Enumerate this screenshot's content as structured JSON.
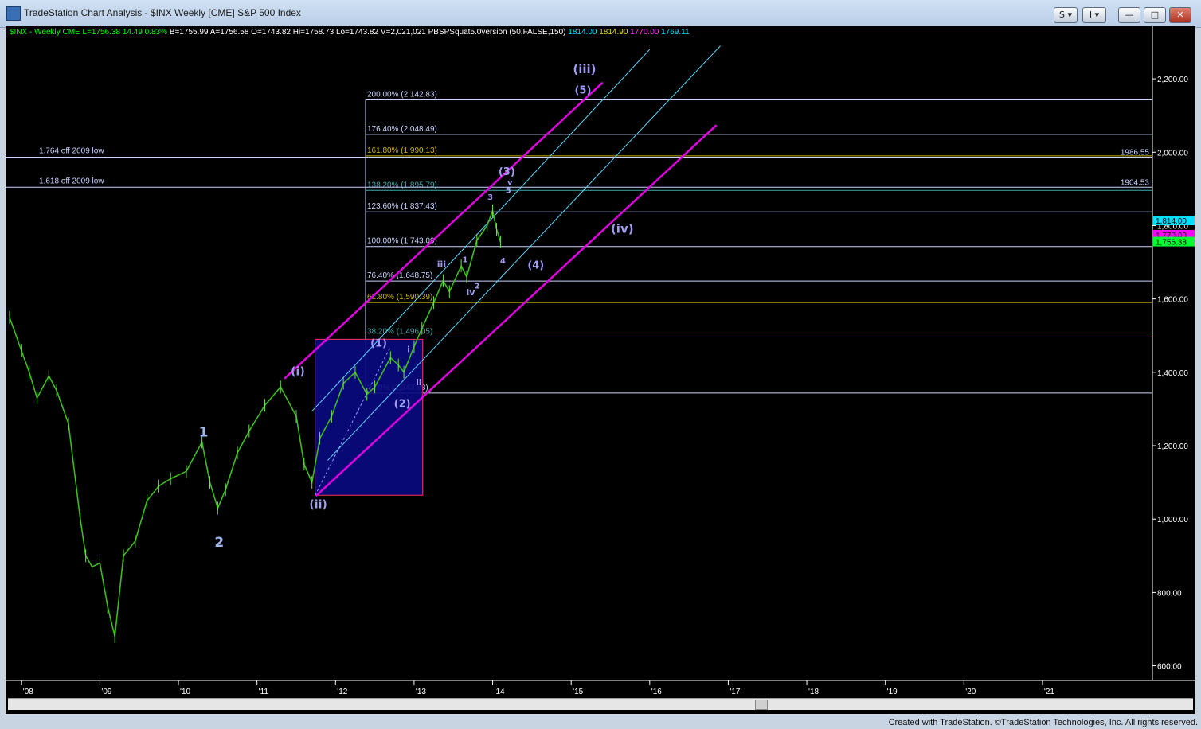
{
  "window": {
    "title": "TradeStation Chart Analysis - $INX Weekly [CME] S&P 500 Index",
    "buttons": {
      "s_label": "S ▾",
      "i_label": "I ▾",
      "min": "—",
      "max": "□",
      "close": "✕"
    }
  },
  "header": {
    "symbol": "$INX - Weekly  CME",
    "last": "L=1756.38",
    "chg": "14.49",
    "pct": "0.83%",
    "bid": "B=1755.99",
    "ask": "A=1756.58",
    "open": "O=1743.82",
    "high": "Hi=1758.73",
    "low": "Lo=1743.82",
    "vol": "V=2,021,021",
    "indicator": "PBSPSquat5.0version (50,FALSE,150)",
    "ind_v1": "1814.00",
    "ind_v2": "1814.90",
    "ind_v3": "1770.00",
    "ind_v4": "1769.11"
  },
  "footer": {
    "credit": "Created with TradeStation. ©TradeStation Technologies, Inc. All rights reserved."
  },
  "chart_data": {
    "type": "line",
    "title": "$INX Weekly S&P 500 Index",
    "ylim": [
      560,
      2300
    ],
    "y_ticks": [
      600,
      800,
      1000,
      1200,
      1400,
      1600,
      1800,
      2000,
      2200
    ],
    "y_tick_labels": [
      "600.00",
      "800.00",
      "1,000.00",
      "1,200.00",
      "1,400.00",
      "1,600.00",
      "1,800.00",
      "2,000.00",
      "2,200.00"
    ],
    "x_range_years": [
      2007.85,
      2022.4
    ],
    "x_ticks": [
      2008,
      2009,
      2010,
      2011,
      2012,
      2013,
      2014,
      2015,
      2016,
      2017,
      2018,
      2019,
      2020,
      2021
    ],
    "x_tick_labels": [
      "'08",
      "'09",
      "'10",
      "'11",
      "'12",
      "'13",
      "'14",
      "'15",
      "'16",
      "'17",
      "'18",
      "'19",
      "'20",
      "'21"
    ],
    "series": [
      {
        "x": [
          2007.85,
          2008.0,
          2008.1,
          2008.2,
          2008.35,
          2008.45,
          2008.6,
          2008.75,
          2008.82,
          2008.9,
          2009.0,
          2009.1,
          2009.19,
          2009.3,
          2009.45,
          2009.6,
          2009.75,
          2009.9,
          2010.1,
          2010.3,
          2010.4,
          2010.5,
          2010.6,
          2010.75,
          2010.9,
          2011.1,
          2011.3,
          2011.5,
          2011.6,
          2011.7,
          2011.8,
          2011.95,
          2012.1,
          2012.25,
          2012.4,
          2012.5,
          2012.7,
          2012.8,
          2012.87,
          2013.0,
          2013.1,
          2013.25,
          2013.37,
          2013.45,
          2013.6,
          2013.67,
          2013.8,
          2013.93,
          2014.0,
          2014.05,
          2014.1
        ],
        "values": [
          1550,
          1460,
          1400,
          1330,
          1390,
          1350,
          1260,
          1000,
          900,
          870,
          880,
          760,
          680,
          900,
          940,
          1050,
          1090,
          1110,
          1130,
          1210,
          1100,
          1030,
          1080,
          1180,
          1240,
          1310,
          1360,
          1280,
          1150,
          1100,
          1220,
          1280,
          1370,
          1400,
          1340,
          1360,
          1440,
          1420,
          1400,
          1470,
          1520,
          1590,
          1650,
          1620,
          1690,
          1660,
          1760,
          1800,
          1840,
          1790,
          1756
        ]
      }
    ],
    "channels": [
      {
        "name": "outer",
        "color": "#e000e0",
        "points": [
          [
            2011.35,
            1383
          ],
          [
            2015.4,
            2190
          ]
        ]
      },
      {
        "name": "lower",
        "color": "#e000e0",
        "points": [
          [
            2011.75,
            1063
          ],
          [
            2016.85,
            2074
          ]
        ]
      },
      {
        "name": "inner-a",
        "color": "#5ad8ff",
        "points": [
          [
            2011.7,
            1294
          ],
          [
            2016.0,
            2280
          ]
        ]
      },
      {
        "name": "inner-b",
        "color": "#5ad8ff",
        "points": [
          [
            2011.9,
            1160
          ],
          [
            2016.9,
            2290
          ]
        ]
      }
    ],
    "fib_levels": [
      {
        "label": "200.00% (2,142.83)",
        "value": 2142.83,
        "color": "#c9d3ff"
      },
      {
        "label": "176.40% (2,048.49)",
        "value": 2048.49,
        "color": "#c9d3ff"
      },
      {
        "label": "161.80% (1,990.13)",
        "value": 1990.13,
        "color": "#c8b400"
      },
      {
        "label": "138.20% (1,895.79)",
        "value": 1895.79,
        "color": "#3fa9a9"
      },
      {
        "label": "123.60% (1,837.43)",
        "value": 1837.43,
        "color": "#c9d3ff"
      },
      {
        "label": "100.00% (1,743.09)",
        "value": 1743.09,
        "color": "#c9d3ff"
      },
      {
        "label": "76.40% (1,648.75)",
        "value": 1648.75,
        "color": "#c9d3ff"
      },
      {
        "label": "61.80% (1,590.39)",
        "value": 1590.39,
        "color": "#c8b400"
      },
      {
        "label": "38.20% (1,496.05)",
        "value": 1496.05,
        "color": "#3fa9a9"
      },
      {
        "label": "0.00% (1,343.38)",
        "value": 1343.38,
        "color": "#c9d3ff"
      }
    ],
    "long_levels": [
      {
        "label": "1.764 off 2009 low",
        "value": 1986.55,
        "right_label": "1986.55"
      },
      {
        "label": "1.618 off 2009 low",
        "value": 1904.53,
        "right_label": "1904.53"
      }
    ],
    "wave_labels": [
      {
        "text": "1",
        "x": 2010.32,
        "y": 1225,
        "color": "#9fb8e8",
        "size": 17
      },
      {
        "text": "2",
        "x": 2010.52,
        "y": 925,
        "color": "#9fb8e8",
        "size": 17
      },
      {
        "text": "(i)",
        "x": 2011.52,
        "y": 1392,
        "color": "#a09cf0",
        "size": 14
      },
      {
        "text": "(ii)",
        "x": 2011.78,
        "y": 1030,
        "color": "#a09cf0",
        "size": 14
      },
      {
        "text": "(1)",
        "x": 2012.55,
        "y": 1470,
        "color": "#a09cf0",
        "size": 13
      },
      {
        "text": "(2)",
        "x": 2012.85,
        "y": 1305,
        "color": "#a09cf0",
        "size": 13
      },
      {
        "text": "i",
        "x": 2012.93,
        "y": 1455,
        "color": "#a09cf0",
        "size": 11
      },
      {
        "text": "ii",
        "x": 2013.06,
        "y": 1365,
        "color": "#a09cf0",
        "size": 11
      },
      {
        "text": "iii",
        "x": 2013.35,
        "y": 1687,
        "color": "#a09cf0",
        "size": 11
      },
      {
        "text": "iv",
        "x": 2013.72,
        "y": 1610,
        "color": "#a09cf0",
        "size": 11
      },
      {
        "text": "1",
        "x": 2013.65,
        "y": 1700,
        "color": "#a09cf0",
        "size": 10
      },
      {
        "text": "2",
        "x": 2013.8,
        "y": 1628,
        "color": "#a09cf0",
        "size": 10
      },
      {
        "text": "3",
        "x": 2013.97,
        "y": 1870,
        "color": "#a09cf0",
        "size": 10
      },
      {
        "text": "4",
        "x": 2014.13,
        "y": 1697,
        "color": "#a09cf0",
        "size": 10
      },
      {
        "text": "(3)",
        "x": 2014.18,
        "y": 1938,
        "color": "#a09cf0",
        "size": 13
      },
      {
        "text": "v",
        "x": 2014.22,
        "y": 1911,
        "color": "#a09cf0",
        "size": 10
      },
      {
        "text": "5",
        "x": 2014.2,
        "y": 1889,
        "color": "#a09cf0",
        "size": 10
      },
      {
        "text": "(4)",
        "x": 2014.55,
        "y": 1683,
        "color": "#a09cf0",
        "size": 13
      },
      {
        "text": "(5)",
        "x": 2015.15,
        "y": 2160,
        "color": "#a09cf0",
        "size": 13
      },
      {
        "text": "(iii)",
        "x": 2015.17,
        "y": 2215,
        "color": "#a09cf0",
        "size": 15
      },
      {
        "text": "(iv)",
        "x": 2015.65,
        "y": 1780,
        "color": "#a09cf0",
        "size": 15
      }
    ],
    "price_markers": [
      {
        "label": "1,814.00",
        "value": 1814.0,
        "bg": "#00e0ff",
        "fg": "#000000"
      },
      {
        "label": "1,770.00",
        "value": 1775.0,
        "bg": "#ff00ff",
        "fg": "#000000"
      },
      {
        "label": "1,756.38",
        "value": 1756.38,
        "bg": "#00ff33",
        "fg": "#000000"
      }
    ]
  }
}
